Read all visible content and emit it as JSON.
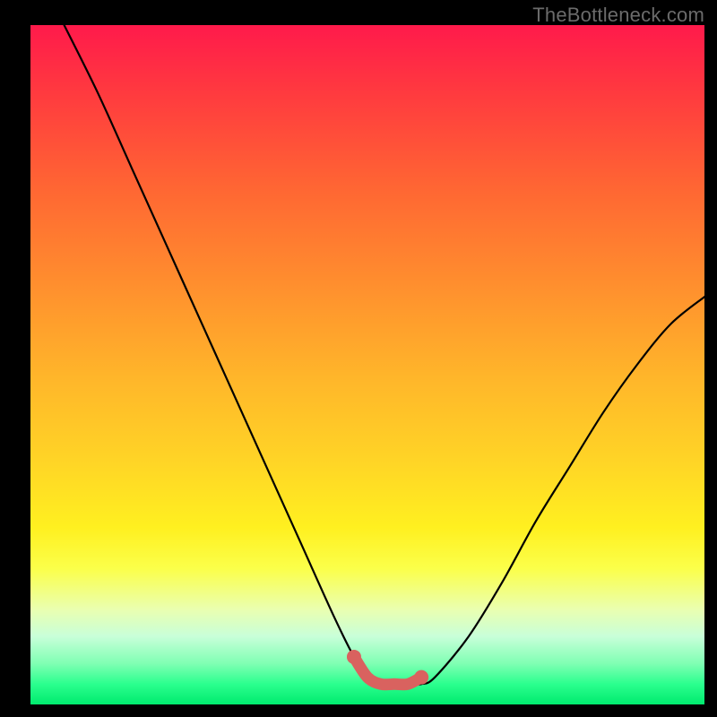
{
  "watermark": "TheBottleneck.com",
  "chart_data": {
    "type": "line",
    "title": "",
    "xlabel": "",
    "ylabel": "",
    "xlim": [
      0,
      100
    ],
    "ylim": [
      0,
      100
    ],
    "series": [
      {
        "name": "bottleneck-curve",
        "x": [
          5,
          10,
          15,
          20,
          25,
          30,
          35,
          40,
          45,
          48,
          50,
          52,
          54,
          56,
          58,
          60,
          65,
          70,
          75,
          80,
          85,
          90,
          95,
          100
        ],
        "y": [
          100,
          90,
          79,
          68,
          57,
          46,
          35,
          24,
          13,
          7,
          4,
          3,
          3,
          3,
          3,
          4,
          10,
          18,
          27,
          35,
          43,
          50,
          56,
          60
        ]
      }
    ],
    "highlight": {
      "name": "optimal-zone",
      "x": [
        48,
        50,
        52,
        54,
        56,
        58
      ],
      "y": [
        7,
        4,
        3,
        3,
        3,
        4
      ],
      "color": "#d9625f"
    },
    "gradient_stops": [
      {
        "pos": 0.0,
        "color": "#ff1a4b"
      },
      {
        "pos": 0.25,
        "color": "#ff7a30"
      },
      {
        "pos": 0.55,
        "color": "#ffd028"
      },
      {
        "pos": 0.8,
        "color": "#f6ff40"
      },
      {
        "pos": 0.92,
        "color": "#b0ffce"
      },
      {
        "pos": 1.0,
        "color": "#00ea6e"
      }
    ]
  }
}
